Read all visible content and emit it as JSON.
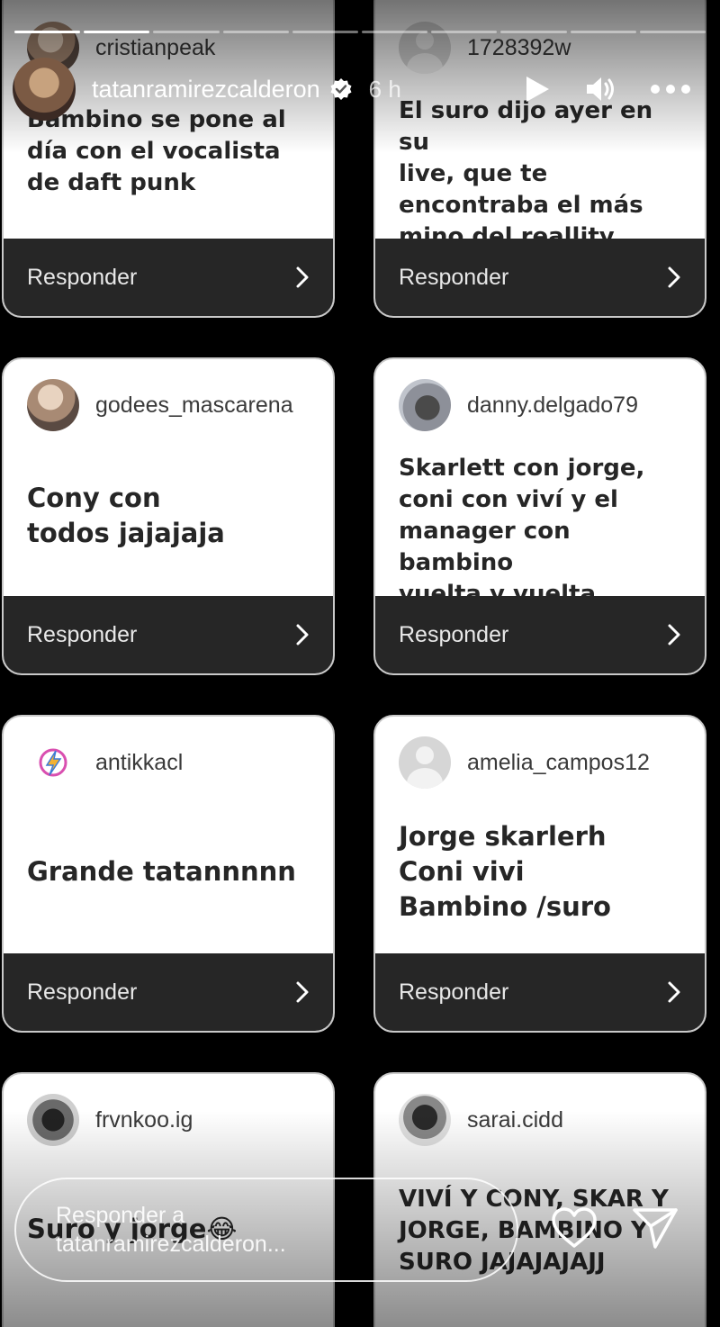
{
  "story": {
    "username": "tatanramirezcalderon",
    "time": "6 h",
    "segments_total": 10,
    "segments_done": 2
  },
  "cards": [
    {
      "username": "cristianpeak",
      "text": "Bambino se pone al\ndía con el vocalista\nde daft punk",
      "button": "Responder"
    },
    {
      "username": "1728392w",
      "text": "El suro dijo ayer en su\nlive, que te\nencontraba el más\nmino del reallity",
      "button": "Responder"
    },
    {
      "username": "godees_mascarena",
      "text": "Cony  con\ntodos jajajaja",
      "button": "Responder"
    },
    {
      "username": "danny.delgado79",
      "text": "Skarlett con jorge,\nconi con viví y el\nmanager con bambino\nvuelta y vuelta",
      "button": "Responder"
    },
    {
      "username": "antikkacl",
      "text": "Grande tatannnnn",
      "button": "Responder"
    },
    {
      "username": "amelia_campos12",
      "text": "Jorge skarlerh\nConi vivi\nBambino /suro",
      "button": "Responder"
    },
    {
      "username": "frvnkoo.ig",
      "text": "Suro y jorge😂",
      "button": "Responder"
    },
    {
      "username": "sarai.cidd",
      "text": "VIVÍ Y CONY, SKAR Y\nJORGE, BAMBINO Y\nSURO JAJAJAJAJJ",
      "button": "Responder"
    }
  ],
  "reply": {
    "placeholder_line1": "Responder a",
    "placeholder_line2": "tatanramirezcalderon..."
  }
}
